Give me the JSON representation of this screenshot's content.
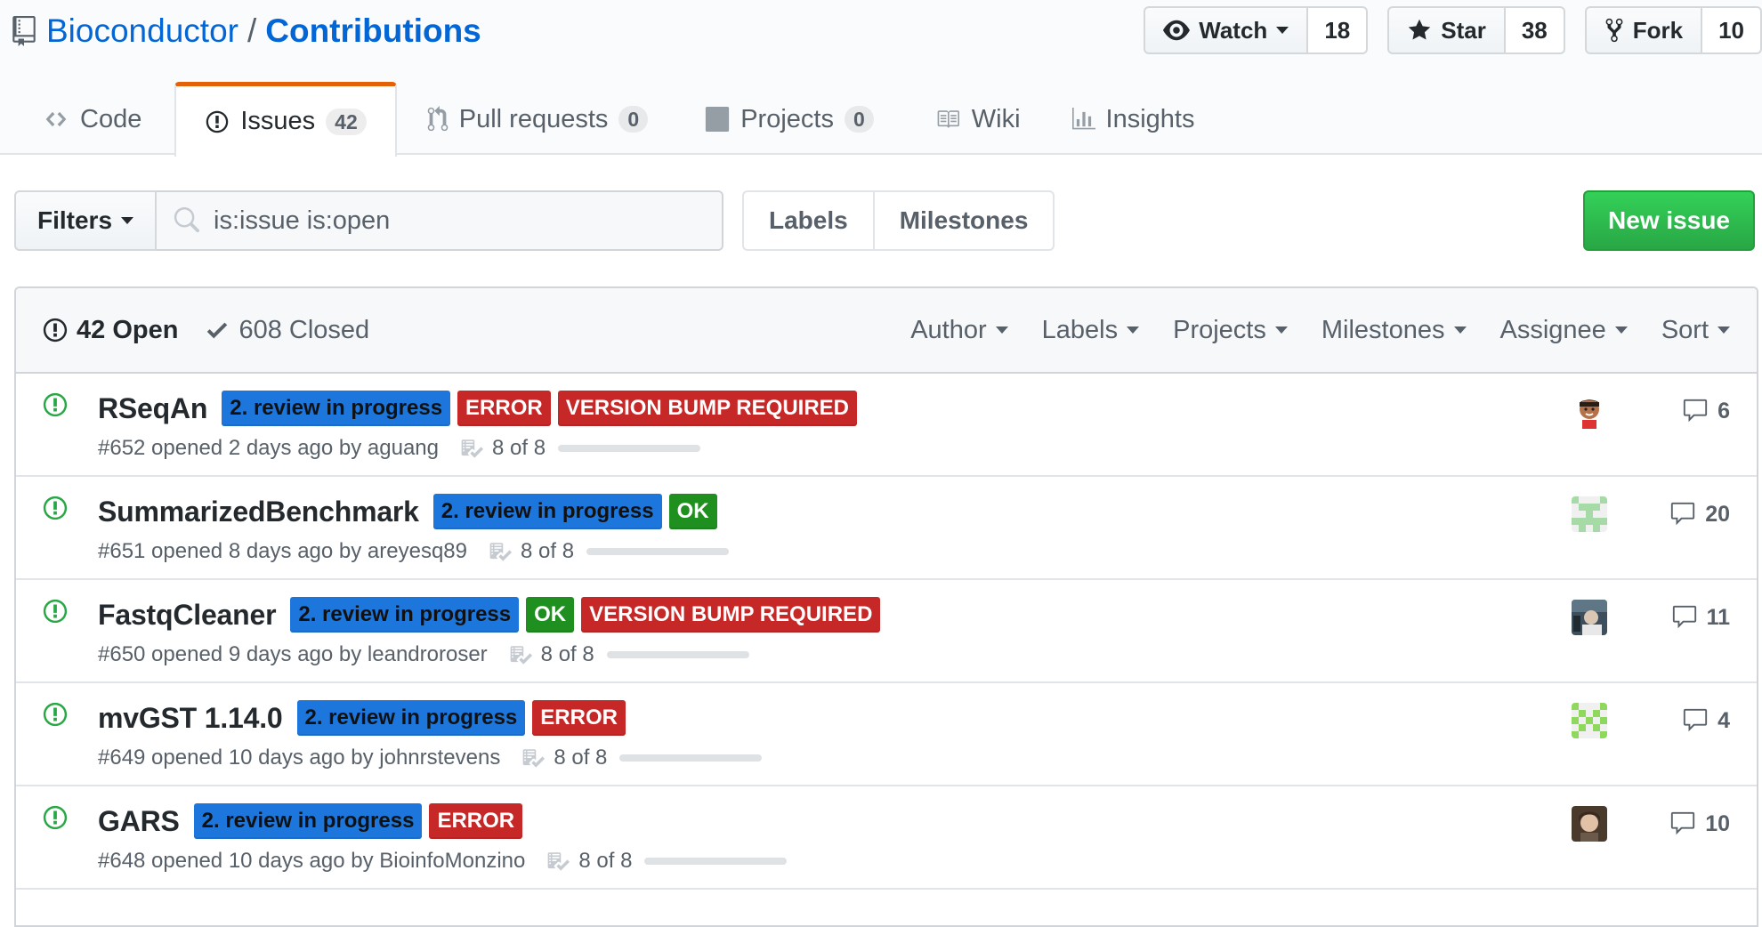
{
  "repo": {
    "owner": "Bioconductor",
    "separator": "/",
    "name": "Contributions"
  },
  "actions": {
    "watch": {
      "label": "Watch",
      "count": "18"
    },
    "star": {
      "label": "Star",
      "count": "38"
    },
    "fork": {
      "label": "Fork",
      "count": "10"
    }
  },
  "tabs": [
    {
      "label": "Code",
      "icon": "code-icon"
    },
    {
      "label": "Issues",
      "count": "42",
      "icon": "issue-opened-icon",
      "selected": true
    },
    {
      "label": "Pull requests",
      "count": "0",
      "icon": "git-pull-request-icon"
    },
    {
      "label": "Projects",
      "count": "0",
      "icon": "project-icon"
    },
    {
      "label": "Wiki",
      "icon": "book-icon"
    },
    {
      "label": "Insights",
      "icon": "graph-icon"
    }
  ],
  "subnav": {
    "filters_label": "Filters",
    "search_value": "is:issue is:open",
    "labels_link": "Labels",
    "milestones_link": "Milestones",
    "new_issue": "New issue"
  },
  "list_header": {
    "open": "42 Open",
    "closed": "608 Closed",
    "filters": [
      "Author",
      "Labels",
      "Projects",
      "Milestones",
      "Assignee",
      "Sort"
    ]
  },
  "issues": [
    {
      "title": "RSeqAn",
      "labels": [
        "2. review in progress",
        "ERROR",
        "VERSION BUMP REQUIRED"
      ],
      "meta": "#652 opened 2 days ago by aguang",
      "tasks": "8 of 8",
      "task_progress": 1.0,
      "comments": "6",
      "avatar": "bitmoji-avatar"
    },
    {
      "title": "SummarizedBenchmark",
      "labels": [
        "2. review in progress",
        "OK"
      ],
      "meta": "#651 opened 8 days ago by areyesq89",
      "tasks": "8 of 8",
      "task_progress": 1.0,
      "comments": "20",
      "avatar": "identicon-avatar"
    },
    {
      "title": "FastqCleaner",
      "labels": [
        "2. review in progress",
        "OK",
        "VERSION BUMP REQUIRED"
      ],
      "meta": "#650 opened 9 days ago by leandroroser",
      "tasks": "8 of 8",
      "task_progress": 1.0,
      "comments": "11",
      "avatar": "photo-avatar"
    },
    {
      "title": "mvGST 1.14.0",
      "labels": [
        "2. review in progress",
        "ERROR"
      ],
      "meta": "#649 opened 10 days ago by johnrstevens",
      "tasks": "8 of 8",
      "task_progress": 1.0,
      "comments": "4",
      "avatar": "identicon-avatar"
    },
    {
      "title": "GARS",
      "labels": [
        "2. review in progress",
        "ERROR"
      ],
      "meta": "#648 opened 10 days ago by BioinfoMonzino",
      "tasks": "8 of 8",
      "task_progress": 1.0,
      "comments": "10",
      "avatar": "photo-avatar"
    }
  ],
  "colors": {
    "link": "#0366d6",
    "label_review": "#1d76db",
    "label_error": "#c62727",
    "label_ok": "#1f8f1f",
    "open_icon": "#28a745",
    "new_issue_bg": "#2cbe4e"
  }
}
